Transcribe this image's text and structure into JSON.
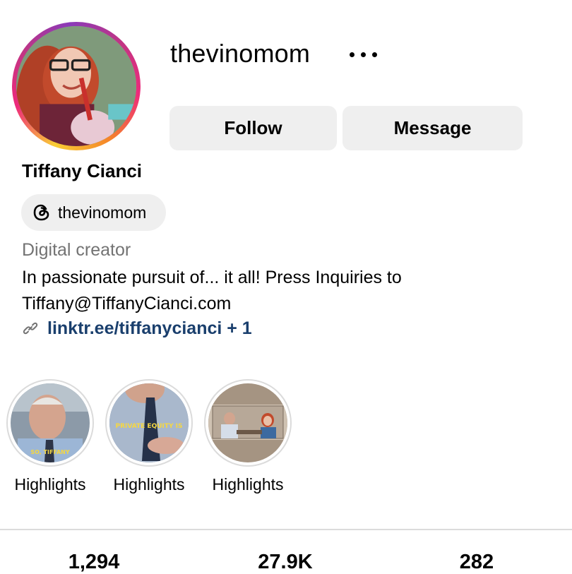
{
  "profile": {
    "username": "thevinomom",
    "full_name": "Tiffany Cianci",
    "threads_handle": "thevinomom",
    "category": "Digital creator",
    "bio_line1": "In passionate pursuit of... it all! Press Inquiries to",
    "bio_line2": "Tiffany@TiffanyCianci.com",
    "link_text": "linktr.ee/tiffanycianci + 1"
  },
  "actions": {
    "follow_label": "Follow",
    "message_label": "Message",
    "more_icon": "more-horizontal-icon"
  },
  "highlights": [
    {
      "label": "Highlights",
      "caption": "SO, TIFFANY"
    },
    {
      "label": "Highlights",
      "caption": "PRIVATE EQUITY IS"
    },
    {
      "label": "Highlights",
      "caption": ""
    }
  ],
  "stats": {
    "posts": "1,294",
    "followers": "27.9K",
    "following": "282"
  },
  "colors": {
    "button_bg": "#efefef",
    "link": "#1a3f6d",
    "secondary_text": "#737373",
    "divider": "#dbdbdb"
  }
}
